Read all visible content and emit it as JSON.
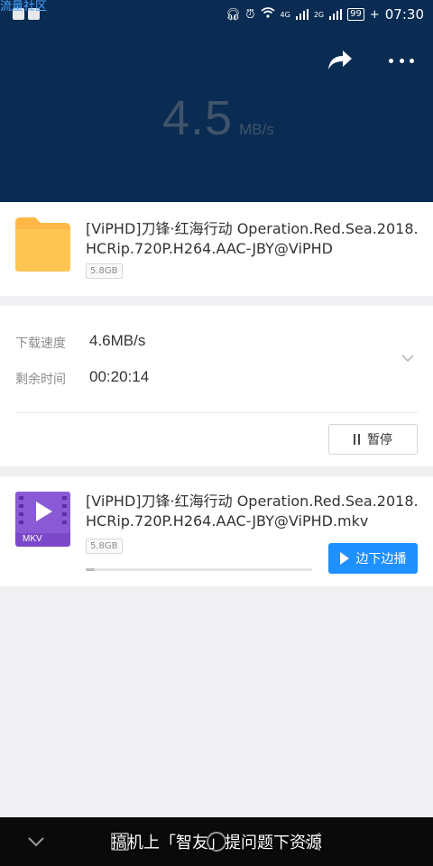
{
  "status_bar": {
    "watermark": "流量社区",
    "network_4g": "4G",
    "network_2g": "2G",
    "battery": "99",
    "time": "07:30"
  },
  "header": {
    "speed_value": "4.5",
    "speed_unit": "MB/s",
    "background_color": "#0a2c52"
  },
  "task": {
    "name": "[ViPHD]刀锋·红海行动 Operation.Red.Sea.2018.HCRip.720P.H264.AAC-JBY@ViPHD",
    "size": "5.8GB"
  },
  "info": {
    "speed_label": "下载速度",
    "speed_value": "4.6MB/s",
    "remaining_label": "剩余时间",
    "remaining_value": "00:20:14",
    "pause_label": "暂停"
  },
  "file": {
    "name": "[ViPHD]刀锋·红海行动 Operation.Red.Sea.2018.HCRip.720P.H264.AAC-JBY@ViPHD.mkv",
    "size": "5.8GB",
    "type_label": "MKV",
    "progress": 0.04,
    "play_label": "边下边播",
    "accent_color": "#1e90ff"
  },
  "caption": "搞机上「智友」提问题下资源"
}
